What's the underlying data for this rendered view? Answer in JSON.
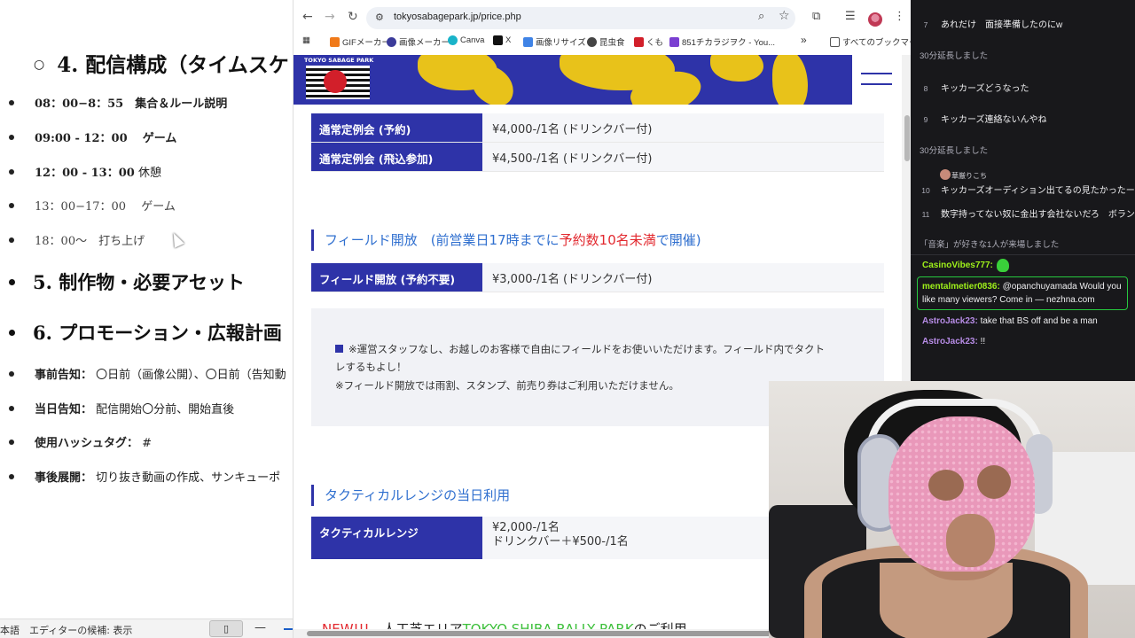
{
  "document": {
    "heading4": "4. 配信構成（タイムスケ",
    "schedule": [
      {
        "time": "08：00−8：55",
        "text": "集合＆ルール説明",
        "bold": true
      },
      {
        "time": "09:00 - 12：00",
        "text": "ゲーム",
        "bold": true
      },
      {
        "time": "12：00 - 13：00",
        "text": "休憩",
        "bold": true
      },
      {
        "time": "13：00−17：00",
        "text": "ゲーム",
        "bold": false
      },
      {
        "time": "18：00〜",
        "text": "打ち上げ",
        "bold": false
      }
    ],
    "heading5": "5. 制作物・必要アセット",
    "heading6": "6. プロモーション・広報計画",
    "promo": [
      {
        "label": "事前告知：",
        "text": "〇日前（画像公開）、〇日前（告知動"
      },
      {
        "label": "当日告知：",
        "text": "配信開始〇分前、開始直後"
      },
      {
        "label": "使用ハッシュタグ：",
        "text": "#"
      },
      {
        "label": "事後展開：",
        "text": "切り抜き動画の作成、サンキューポ"
      }
    ],
    "statusbar": {
      "text": "本語　エディターの候補: 表示",
      "minus": "—"
    }
  },
  "browser": {
    "url": "tokyosabagepark.jp/price.php",
    "bookmarks": [
      {
        "label": "GIFメーカー",
        "color": "#f07a1a"
      },
      {
        "label": "画像メーカー",
        "color": "#3b3b9a"
      },
      {
        "label": "Canva",
        "color": "#19b3c9"
      },
      {
        "label": "X",
        "color": "#111111"
      },
      {
        "label": "画像リサイズ",
        "color": "#3f83e6"
      },
      {
        "label": "昆虫食",
        "color": "#444444"
      },
      {
        "label": "くも",
        "color": "#d21f2a"
      },
      {
        "label": "851チカラジヲク - You...",
        "color": "#7a3fd1"
      }
    ],
    "bookmarks_more": "»",
    "bookmarks_folder": "すべてのブックマーク",
    "logo_text": "TOKYO SABAGE PARK",
    "prices_regular": [
      {
        "label": "通常定例会 (予約)",
        "value": "¥4,000-/1名 (ドリンクバー付)"
      },
      {
        "label": "通常定例会 (飛込参加)",
        "value": "¥4,500-/1名 (ドリンクバー付)"
      }
    ],
    "field_section": {
      "prefix": "フィールド開放　(前営業日17時までに",
      "highlight": "予約数10名未満",
      "suffix": "で開催)"
    },
    "prices_field": [
      {
        "label": "フィールド開放 (予約不要)",
        "value": "¥3,000-/1名 (ドリンクバー付)"
      }
    ],
    "note": {
      "line1": "※運営スタッフなし、お越しのお客様で自由にフィールドをお使いいただけます。フィールド内でタクト",
      "line2": "レするもよし！",
      "line3": "※フィールド開放では雨割、スタンプ、前売り券はご利用いただけません。"
    },
    "tactical_section": "タクティカルレンジの当日利用",
    "tactical": {
      "label": "タクティカルレンジ",
      "value1": "¥2,000-/1名",
      "value2": "ドリンクバー＋¥500-/1名"
    },
    "new_banner": {
      "new": "NEW!!!",
      "mid": "　人工芝エリア",
      "green": "TOKYO SHIBA RALLY PARK",
      "end": "のご利用"
    }
  },
  "chat": {
    "items": [
      {
        "n": "7",
        "text": "あれだけ　面接準備したのにw"
      },
      {
        "n": "8",
        "text": "キッカーズどうなった"
      },
      {
        "n": "9",
        "text": "キッカーズ連絡ないんやね"
      },
      {
        "n": "10",
        "text": "キッカーズオーディション出てるの見たかったー"
      },
      {
        "n": "11",
        "text": "数字持ってない奴に金出す会社ないだろ　ボランティア"
      }
    ],
    "extended_1": "30分延長しました",
    "extended_2": "30分延長しました",
    "mini_user": "華厳りこち",
    "joined": "「音楽」が好きな1人が来場しました",
    "messages": [
      {
        "user": "CasinoVibes777:",
        "text": ""
      },
      {
        "user": "mentalmetier0836:",
        "text": "@opanchuyamada Would you like many viewers? Come in — nezhna.com"
      },
      {
        "user": "AstroJack23:",
        "text": "take that BS off and be a man"
      },
      {
        "user": "AstroJack23:",
        "text": "!!"
      }
    ]
  }
}
